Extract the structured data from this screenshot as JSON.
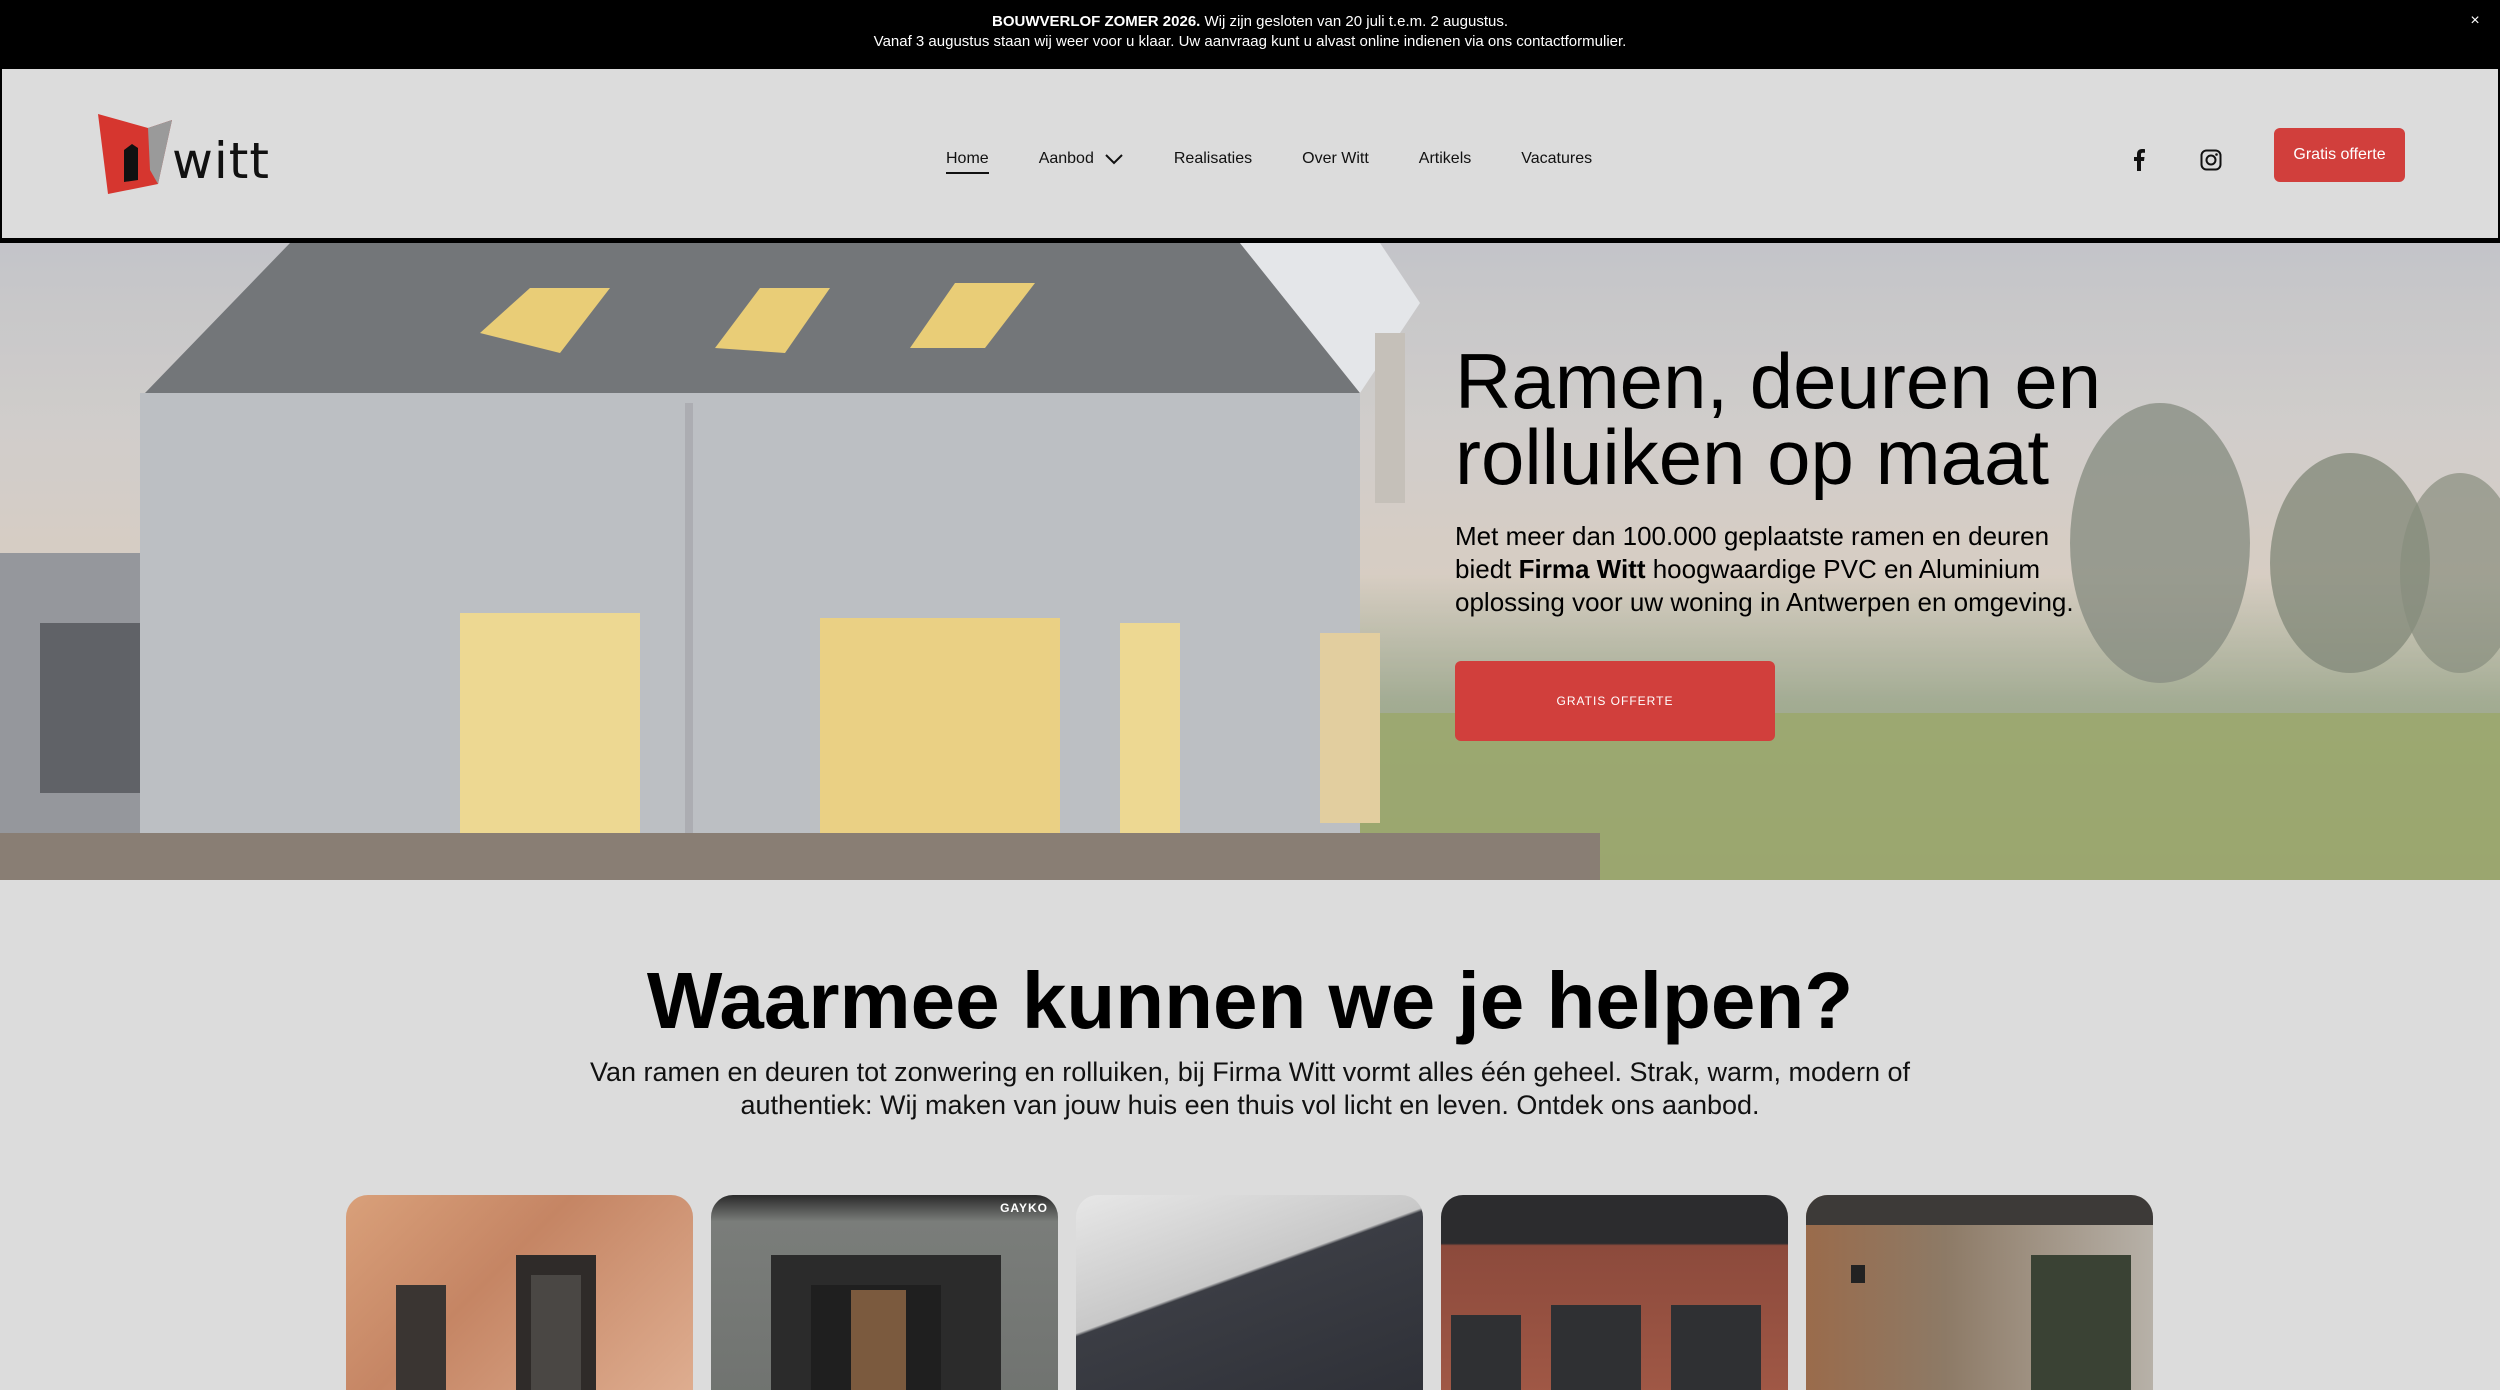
{
  "announcement": {
    "bold": "BOUWVERLOF ZOMER 2026.",
    "line1_rest": " Wij zijn gesloten van 20 juli t.e.m. 2 augustus.",
    "line2": "Vanaf 3 augustus staan wij weer voor u klaar. Uw aanvraag kunt u alvast online indienen via ons contactformulier.",
    "close": "×"
  },
  "header": {
    "logo_text": "witt",
    "nav": [
      "Home",
      "Aanbod",
      "Realisaties",
      "Over Witt",
      "Artikels",
      "Vacatures"
    ],
    "cta": "Gratis offerte",
    "icons": [
      "facebook-icon",
      "instagram-icon",
      "chevron-down-icon"
    ]
  },
  "hero": {
    "title_line1": "Ramen, deuren en",
    "title_line2": "rolluiken op maat",
    "text_before": "Met meer dan 100.000 geplaatste ramen en deuren biedt ",
    "text_bold": "Firma Witt",
    "text_after": " hoogwaardige PVC en Aluminium oplossing voor uw woning in Antwerpen en omgeving.",
    "cta": "GRATIS OFFERTE"
  },
  "services": {
    "title": "Waarmee kunnen we je helpen?",
    "text": "Van ramen en deuren tot zonwering en rolluiken, bij Firma Witt vormt alles één geheel. Strak, warm, modern of authentiek: Wij maken van jouw huis een thuis vol licht en leven. Ontdek ons aanbod.",
    "card_brand": "GAYKO"
  },
  "colors": {
    "accent": "#d13f3c",
    "background": "#dcdcdc",
    "announcement_bg": "#000000"
  }
}
